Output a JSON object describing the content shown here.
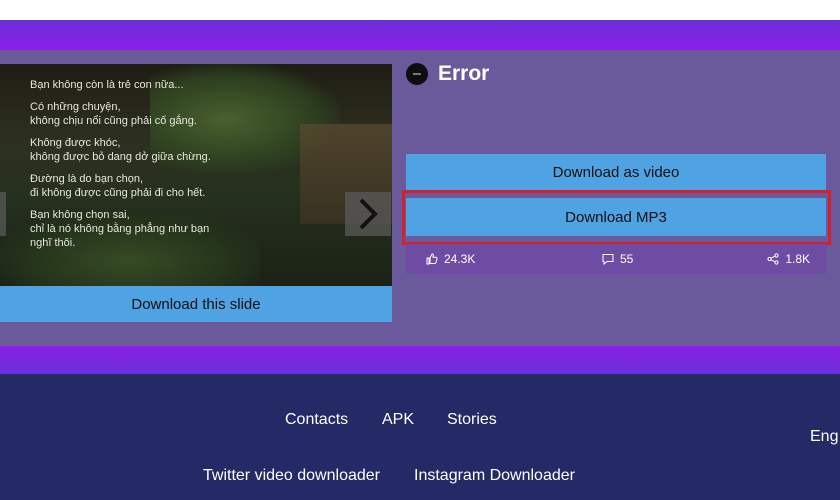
{
  "slide": {
    "lines": [
      "Bạn  không còn là trẻ con nữa...",
      "Có những chuyện,\nkhông chịu nổi cũng phải cố gắng.",
      "Không được khóc,\nkhông được bỏ dang dở giữa chừng.",
      "Đường là do bạn chọn,\nđi không được cũng phải đi cho hết.",
      "Bạn không chọn sai,\nchỉ là nó không bằng phẳng như bạn\nnghĩ thôi."
    ],
    "next_icon": "chevron-right-icon",
    "download_label": "Download this slide"
  },
  "result": {
    "title": "Error",
    "icon": "status-dot-icon",
    "download_video_label": "Download as video",
    "download_mp3_label": "Download MP3",
    "highlight_color": "#d4202a"
  },
  "stats": {
    "likes": "24.3K",
    "comments": "55",
    "shares": "1.8K"
  },
  "footer": {
    "links": [
      "Contacts",
      "APK",
      "Stories"
    ],
    "links2": [
      "Twitter video downloader",
      "Instagram Downloader"
    ],
    "language": "Eng"
  },
  "colors": {
    "button_blue": "#4fa3e3",
    "panel_purple": "#6a5a9c",
    "band_purple": "#8a1fe8",
    "footer_navy": "#232a66"
  }
}
